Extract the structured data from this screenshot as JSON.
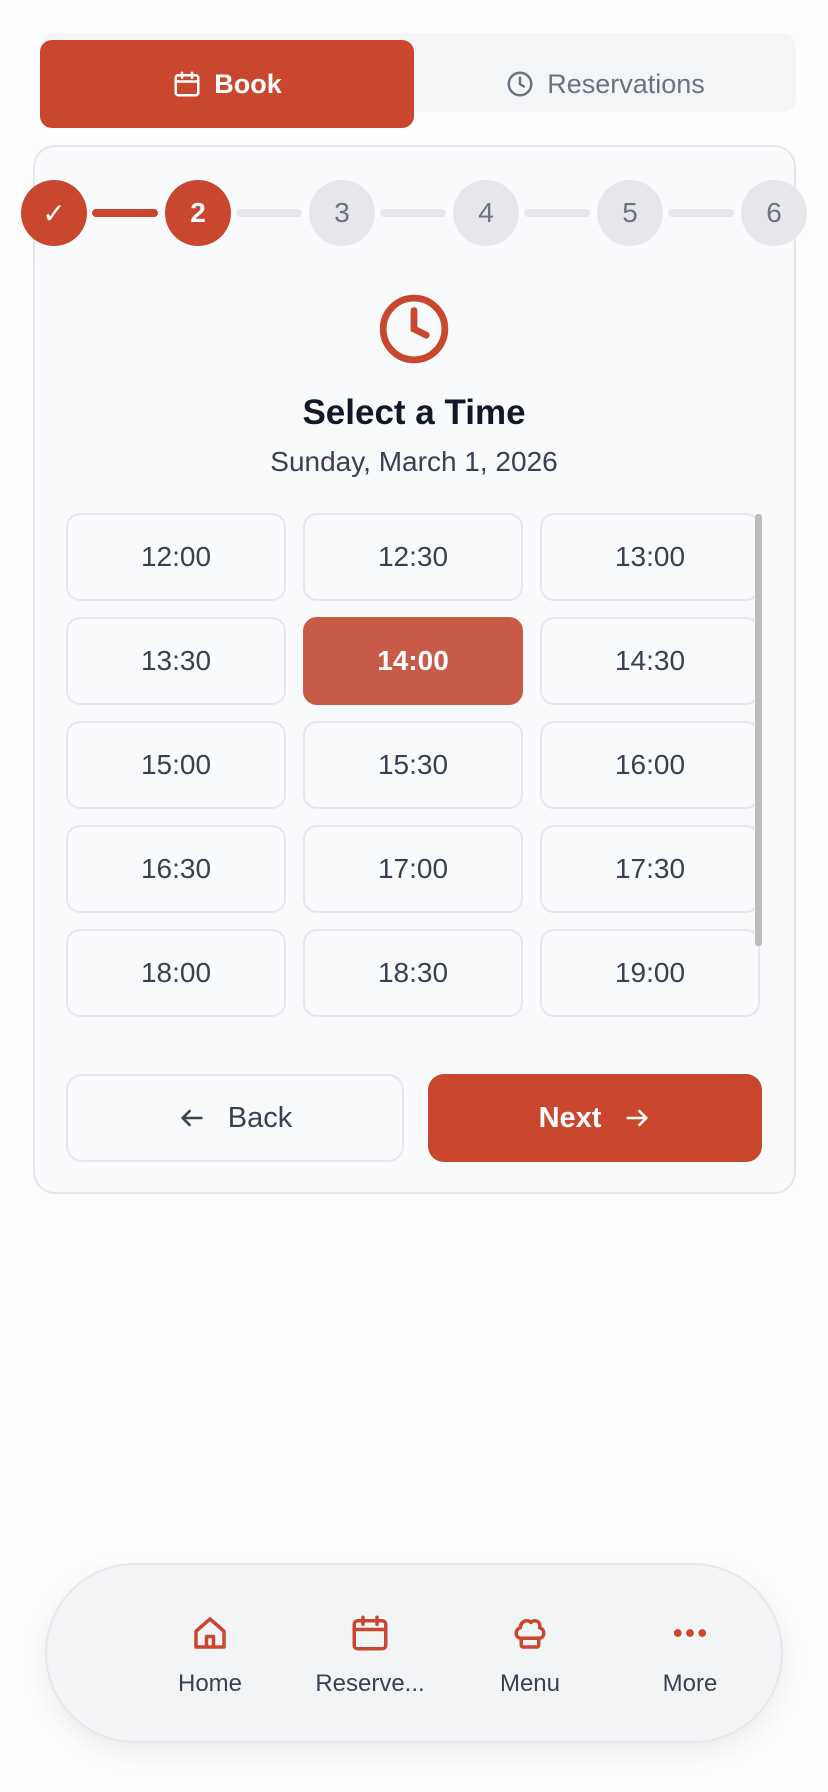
{
  "tabs": {
    "book_label": "Book",
    "reservations_label": "Reservations"
  },
  "stepper": {
    "current_step": 2,
    "steps": [
      "✓",
      "2",
      "3",
      "4",
      "5",
      "6"
    ]
  },
  "main": {
    "title": "Select a Time",
    "date": "Sunday, March 1, 2026",
    "selected_time": "14:00",
    "times": [
      "12:00",
      "12:30",
      "13:00",
      "13:30",
      "14:00",
      "14:30",
      "15:00",
      "15:30",
      "16:00",
      "16:30",
      "17:00",
      "17:30",
      "18:00",
      "18:30",
      "19:00"
    ]
  },
  "actions": {
    "back_label": "Back",
    "next_label": "Next"
  },
  "bottom_nav": {
    "items": [
      {
        "label": "Home",
        "icon": "home-icon"
      },
      {
        "label": "Reserve...",
        "icon": "calendar-icon"
      },
      {
        "label": "Menu",
        "icon": "chef-hat-icon"
      },
      {
        "label": "More",
        "icon": "more-icon"
      }
    ]
  },
  "colors": {
    "accent": "#c8472e",
    "selected_slot": "#c75b48",
    "inactive_step": "#e5e7eb"
  }
}
